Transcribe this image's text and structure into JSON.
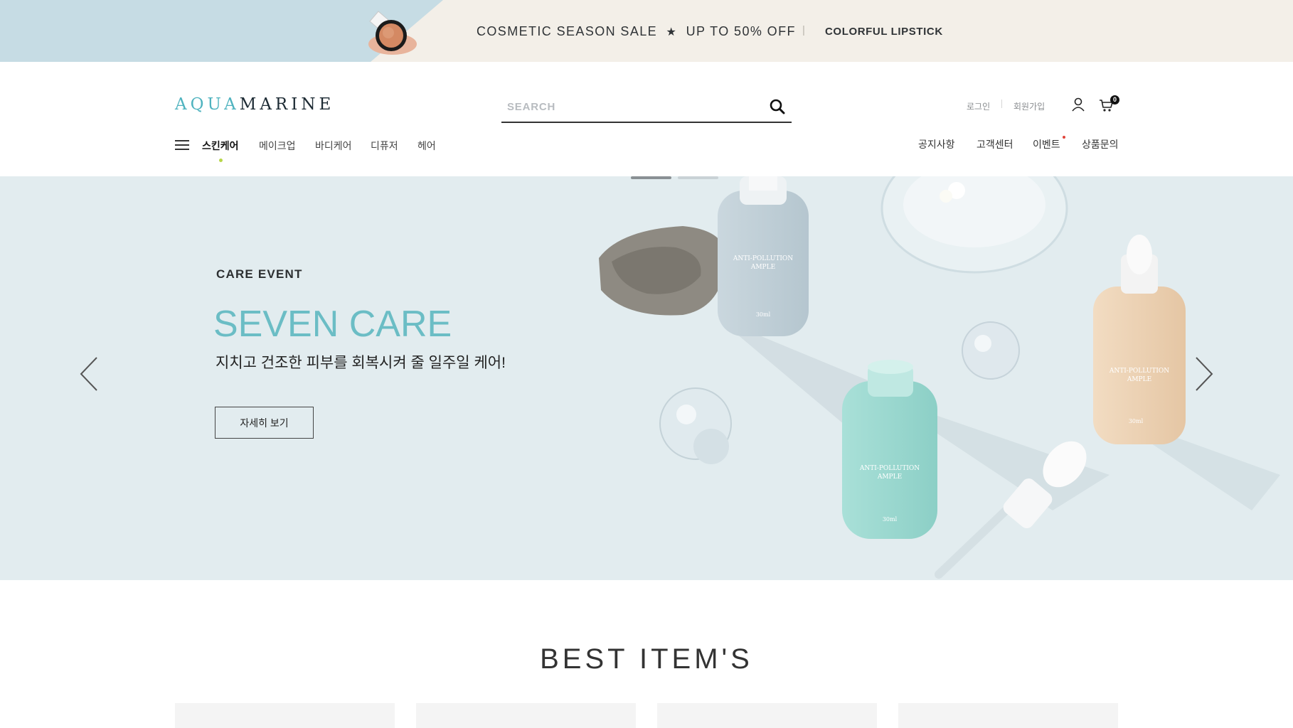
{
  "promo": {
    "text_before_star": "COSMETIC SEASON SALE",
    "star_icon": "★",
    "text_after_star": "UP TO 50% OFF",
    "separator": "|",
    "link": "COLORFUL LIPSTICK"
  },
  "header": {
    "logo_part1": "AQUA",
    "logo_part2": "MARINE",
    "search": {
      "placeholder": "SEARCH"
    },
    "utility": {
      "login": "로그인",
      "signup": "회원가입",
      "cart_count": "0"
    }
  },
  "nav": {
    "items": [
      {
        "label": "스킨케어",
        "active": true
      },
      {
        "label": "메이크업"
      },
      {
        "label": "바디케어"
      },
      {
        "label": "디퓨저"
      },
      {
        "label": "헤어"
      }
    ],
    "right": [
      {
        "label": "공지사항"
      },
      {
        "label": "고객센터"
      },
      {
        "label": "이벤트"
      },
      {
        "label": "상품문의"
      }
    ]
  },
  "hero": {
    "eyebrow": "CARE EVENT",
    "title": "SEVEN CARE",
    "subtitle": "지치고 건조한 피부를 회복시켜 줄 일주일 케어!",
    "button": "자세히 보기",
    "product_labels": {
      "bottle_line1": "ANTI-POLLUTION",
      "bottle_line2": "AMPLE",
      "bottle_volume": "30ml"
    },
    "slides": 2,
    "active_slide": 1
  },
  "best": {
    "title": "BEST ITEM'S"
  },
  "colors": {
    "promo_blue": "#c6dce4",
    "promo_beige": "#f3efe8",
    "accent_teal": "#6bbdc5",
    "logo_teal": "#4fb3bf",
    "hero_bg": "#e2ecef",
    "active_dot": "#b7d648",
    "event_dot": "#e0443a"
  },
  "icons": [
    "compact-powder-image",
    "star-icon",
    "search-icon",
    "user-icon",
    "cart-icon",
    "hamburger-menu-icon",
    "chevron-left-icon",
    "chevron-right-icon"
  ]
}
